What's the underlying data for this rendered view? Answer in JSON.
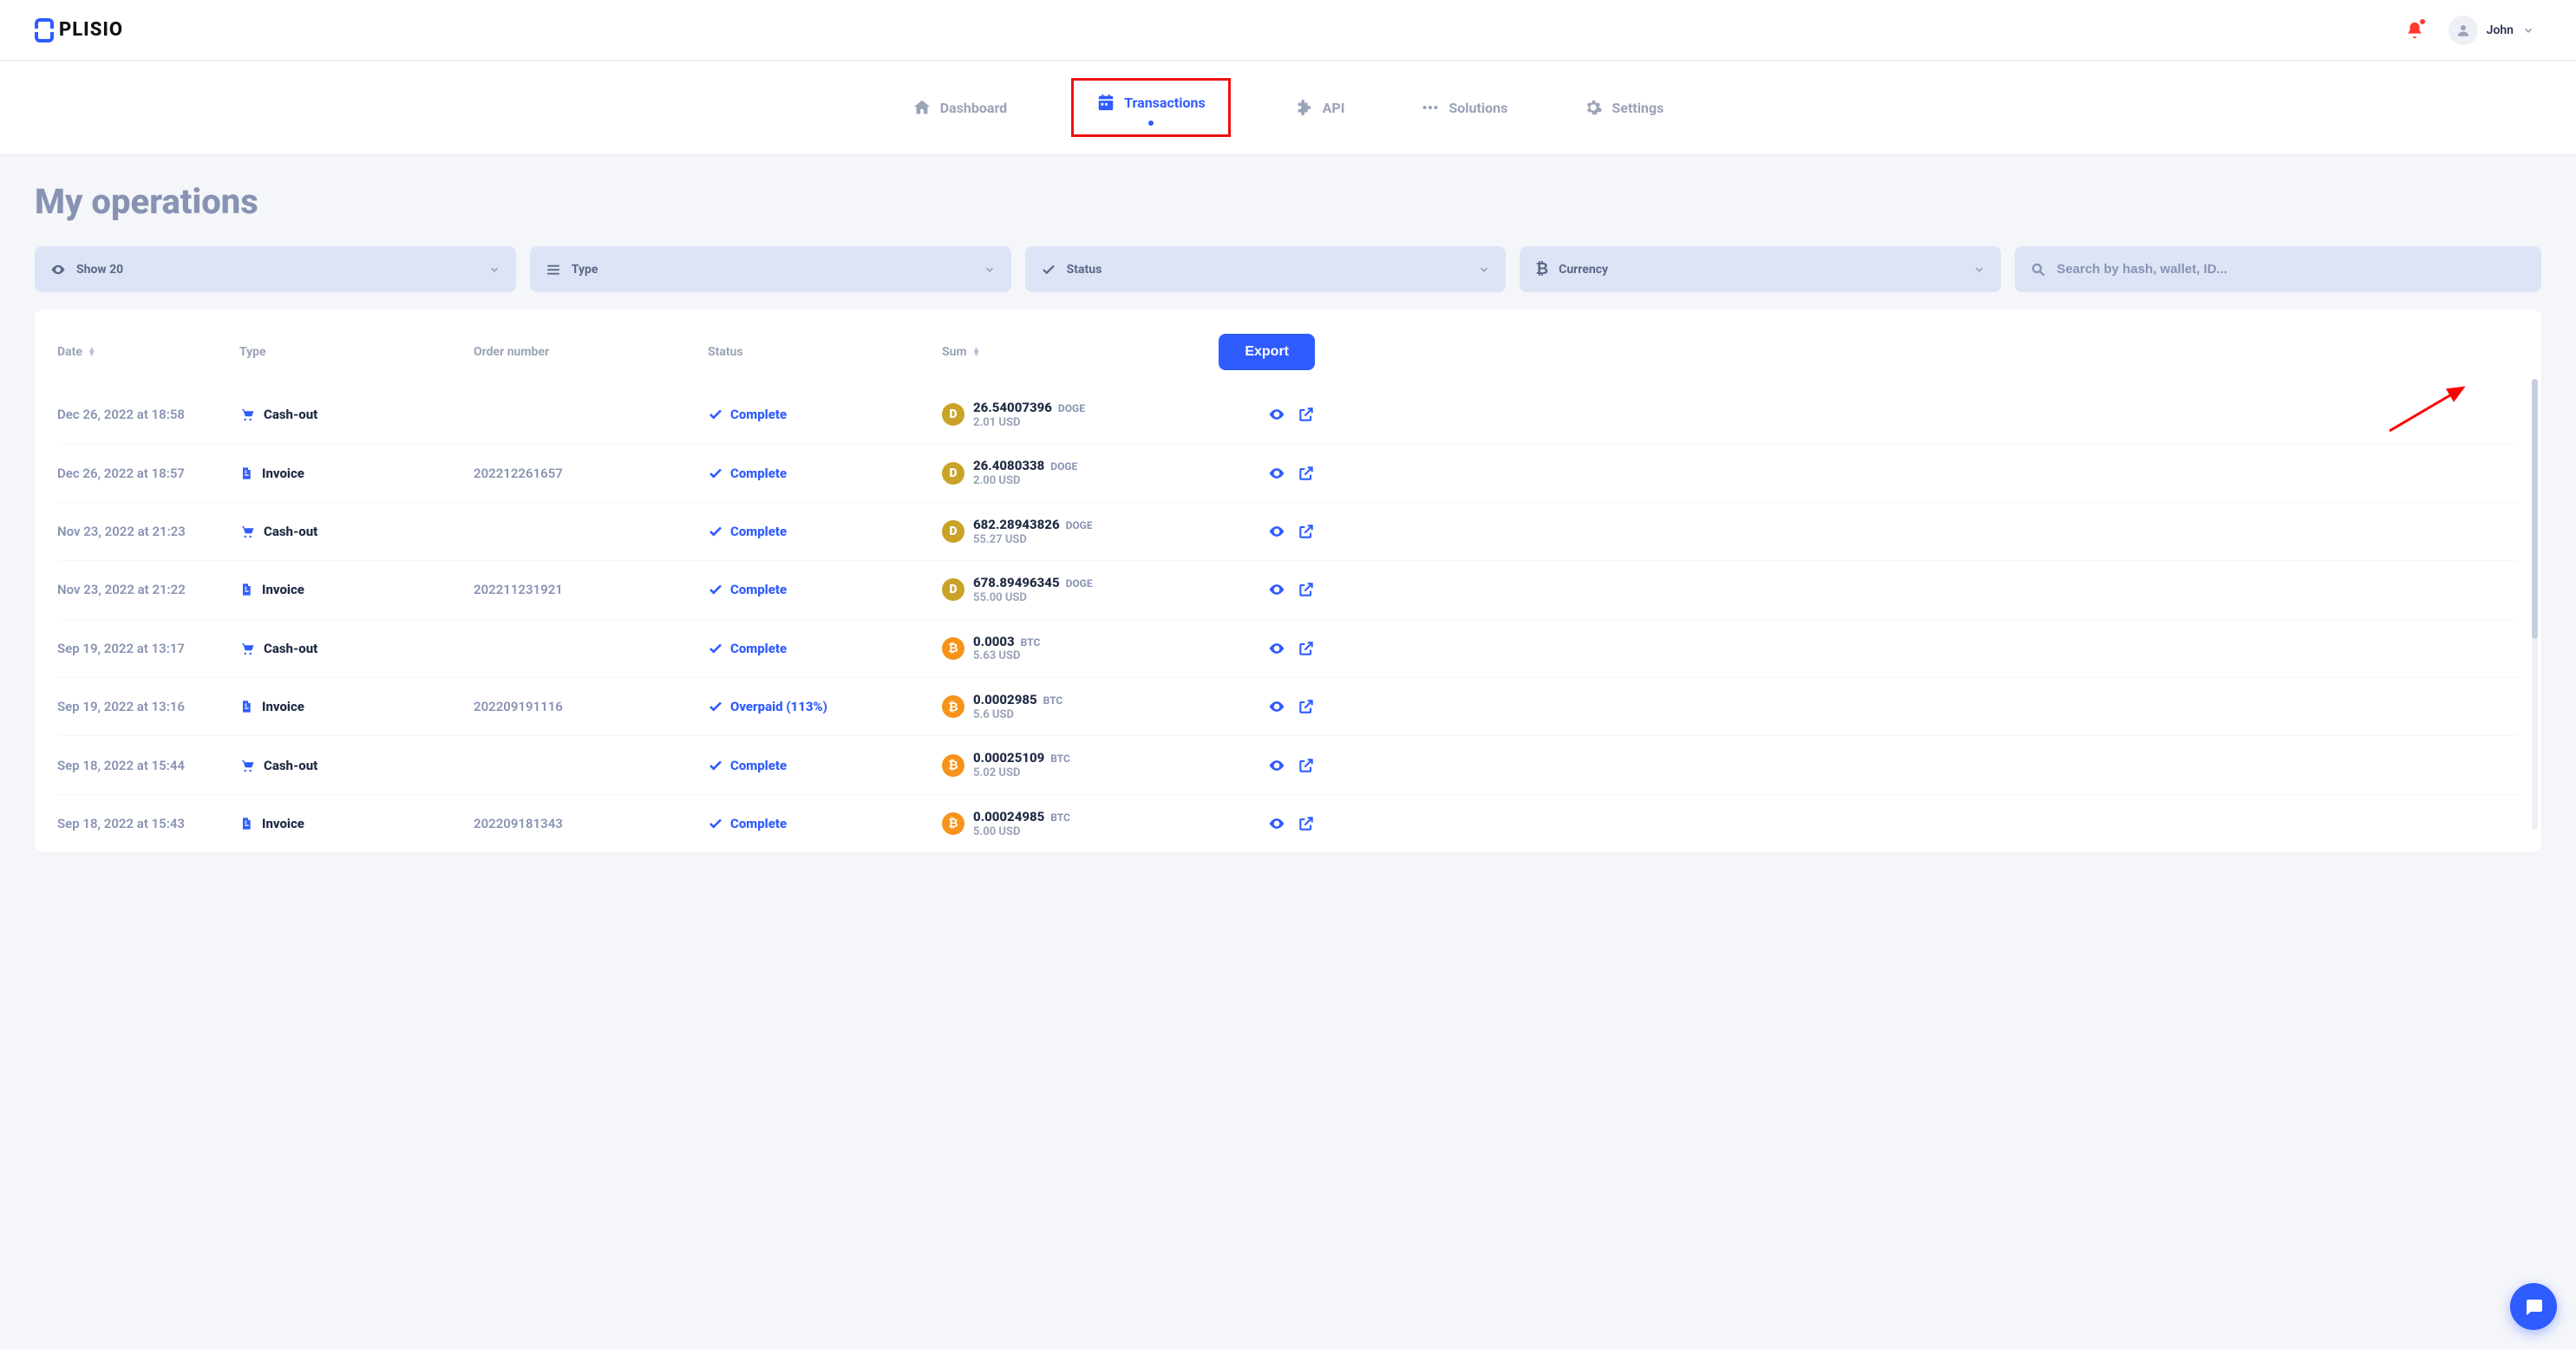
{
  "brand": "PLISIO",
  "user": {
    "name": "John"
  },
  "nav": {
    "dashboard": "Dashboard",
    "transactions": "Transactions",
    "api": "API",
    "solutions": "Solutions",
    "settings": "Settings"
  },
  "page": {
    "title": "My operations"
  },
  "filters": {
    "show": "Show 20",
    "type": "Type",
    "status": "Status",
    "currency": "Currency",
    "search_placeholder": "Search by hash, wallet, ID..."
  },
  "columns": {
    "date": "Date",
    "type": "Type",
    "order": "Order number",
    "status": "Status",
    "sum": "Sum",
    "export": "Export"
  },
  "rows": [
    {
      "date": "Dec 26, 2022 at 18:58",
      "type": "Cash-out",
      "type_kind": "cashout",
      "order": "",
      "status": "Complete",
      "coin": "doge",
      "coin_glyph": "D",
      "amount": "26.54007396",
      "symbol": "DOGE",
      "usd": "2.01 USD"
    },
    {
      "date": "Dec 26, 2022 at 18:57",
      "type": "Invoice",
      "type_kind": "invoice",
      "order": "202212261657",
      "status": "Complete",
      "coin": "doge",
      "coin_glyph": "D",
      "amount": "26.4080338",
      "symbol": "DOGE",
      "usd": "2.00 USD"
    },
    {
      "date": "Nov 23, 2022 at 21:23",
      "type": "Cash-out",
      "type_kind": "cashout",
      "order": "",
      "status": "Complete",
      "coin": "doge",
      "coin_glyph": "D",
      "amount": "682.28943826",
      "symbol": "DOGE",
      "usd": "55.27 USD"
    },
    {
      "date": "Nov 23, 2022 at 21:22",
      "type": "Invoice",
      "type_kind": "invoice",
      "order": "202211231921",
      "status": "Complete",
      "coin": "doge",
      "coin_glyph": "D",
      "amount": "678.89496345",
      "symbol": "DOGE",
      "usd": "55.00 USD"
    },
    {
      "date": "Sep 19, 2022 at 13:17",
      "type": "Cash-out",
      "type_kind": "cashout",
      "order": "",
      "status": "Complete",
      "coin": "btc",
      "coin_glyph": "₿",
      "amount": "0.0003",
      "symbol": "BTC",
      "usd": "5.63 USD"
    },
    {
      "date": "Sep 19, 2022 at 13:16",
      "type": "Invoice",
      "type_kind": "invoice",
      "order": "202209191116",
      "status": "Overpaid (113%)",
      "coin": "btc",
      "coin_glyph": "₿",
      "amount": "0.0002985",
      "symbol": "BTC",
      "usd": "5.6 USD"
    },
    {
      "date": "Sep 18, 2022 at 15:44",
      "type": "Cash-out",
      "type_kind": "cashout",
      "order": "",
      "status": "Complete",
      "coin": "btc",
      "coin_glyph": "₿",
      "amount": "0.00025109",
      "symbol": "BTC",
      "usd": "5.02 USD"
    },
    {
      "date": "Sep 18, 2022 at 15:43",
      "type": "Invoice",
      "type_kind": "invoice",
      "order": "202209181343",
      "status": "Complete",
      "coin": "btc",
      "coin_glyph": "₿",
      "amount": "0.00024985",
      "symbol": "BTC",
      "usd": "5.00 USD"
    }
  ]
}
